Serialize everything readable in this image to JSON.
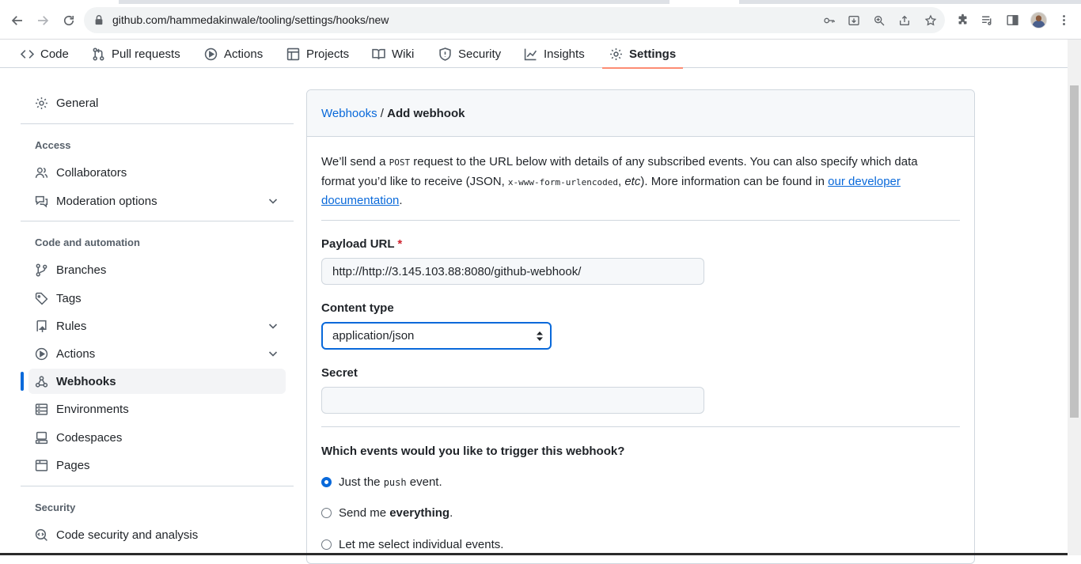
{
  "browser": {
    "url": "github.com/hammedakinwale/tooling/settings/hooks/new"
  },
  "repo_nav": {
    "tabs": [
      {
        "label": "Code",
        "icon": "code-icon"
      },
      {
        "label": "Pull requests",
        "icon": "git-pull-request-icon"
      },
      {
        "label": "Actions",
        "icon": "play-icon"
      },
      {
        "label": "Projects",
        "icon": "table-icon"
      },
      {
        "label": "Wiki",
        "icon": "book-icon"
      },
      {
        "label": "Security",
        "icon": "shield-icon"
      },
      {
        "label": "Insights",
        "icon": "graph-icon"
      },
      {
        "label": "Settings",
        "icon": "gear-icon",
        "selected": true
      }
    ]
  },
  "sidebar": {
    "general": "General",
    "access_heading": "Access",
    "collaborators": "Collaborators",
    "moderation": "Moderation options",
    "code_heading": "Code and automation",
    "branches": "Branches",
    "tags": "Tags",
    "rules": "Rules",
    "actions": "Actions",
    "webhooks": "Webhooks",
    "environments": "Environments",
    "codespaces": "Codespaces",
    "pages": "Pages",
    "security_heading": "Security",
    "code_security": "Code security and analysis"
  },
  "main": {
    "breadcrumb_parent": "Webhooks",
    "breadcrumb_sep": "/",
    "breadcrumb_current": "Add webhook",
    "intro_1": "We’ll send a ",
    "intro_post": "POST",
    "intro_2": " request to the URL below with details of any subscribed events. You can also specify which data format you’d like to receive (JSON, ",
    "intro_code": "x-www-form-urlencoded",
    "intro_3": ", ",
    "intro_etc": "etc",
    "intro_4": "). More information can be found in ",
    "intro_link": "our developer documentation",
    "intro_5": ".",
    "payload_label": "Payload URL",
    "required_mark": "*",
    "payload_value": "http://http://3.145.103.88:8080/github-webhook/",
    "content_type_label": "Content type",
    "content_type_value": "application/json",
    "secret_label": "Secret",
    "secret_value": "",
    "events_question": "Which events would you like to trigger this webhook?",
    "radio_push_pre": "Just the ",
    "radio_push_code": "push",
    "radio_push_post": " event.",
    "radio_all_pre": "Send me ",
    "radio_all_bold": "everything",
    "radio_all_post": ".",
    "radio_select": "Let me select individual events."
  },
  "colors": {
    "accent": "#0969da",
    "selected_tab_underline": "#fd8c73",
    "required": "#cf222e"
  }
}
